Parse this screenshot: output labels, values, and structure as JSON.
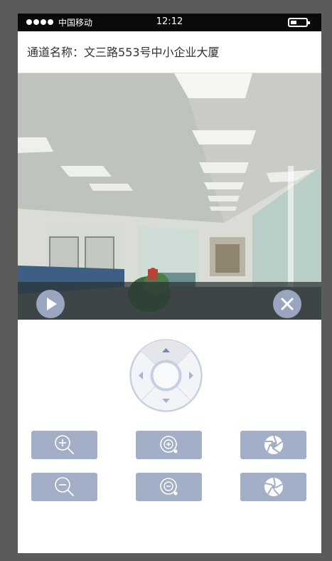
{
  "status_bar": {
    "carrier": "中国移动",
    "time": "12:12"
  },
  "channel": {
    "label": "通道名称：",
    "name": "文三路553号中小企业大厦"
  },
  "video": {
    "controls": [
      "play-icon",
      "close-icon"
    ]
  },
  "ptz": {
    "directions": [
      "up",
      "down",
      "left",
      "right"
    ]
  },
  "buttons": [
    {
      "icon": "zoom-in-icon"
    },
    {
      "icon": "focus-in-icon"
    },
    {
      "icon": "aperture-open-icon"
    },
    {
      "icon": "zoom-out-icon"
    },
    {
      "icon": "focus-out-icon"
    },
    {
      "icon": "aperture-close-icon"
    }
  ],
  "colors": {
    "button": "#a3afc7",
    "icon": "#ffffff",
    "status_bar": "#0a0a0a"
  }
}
